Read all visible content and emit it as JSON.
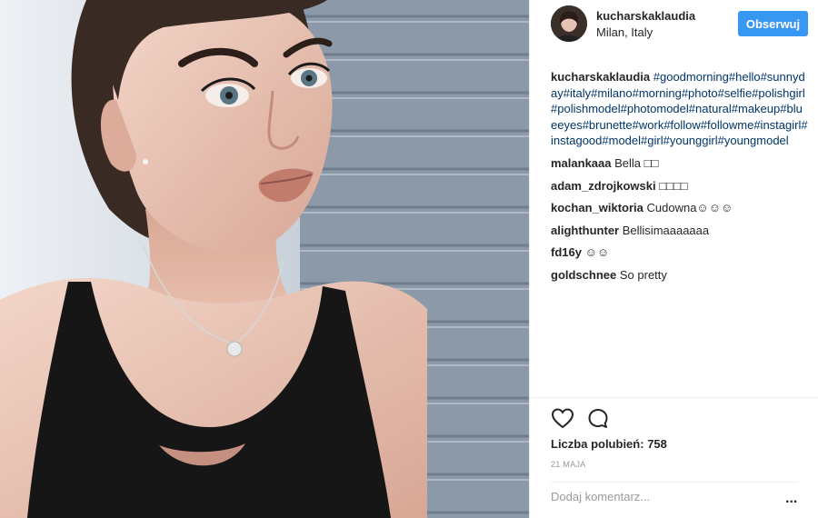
{
  "post": {
    "image_alt": "selfie photo",
    "header": {
      "username": "kucharskaklaudia",
      "location": "Milan, Italy",
      "follow_label": "Obserwuj"
    },
    "caption": {
      "username": "kucharskaklaudia",
      "hashtags": [
        "#goodmorning",
        "#hello",
        "#sunnyday",
        "#italy",
        "#milano",
        "#morning",
        "#photo",
        "#selfie",
        "#polishgirl",
        "#polishmodel",
        "#photomodel",
        "#natural",
        "#makeup",
        "#blueeyes",
        "#brunette",
        "#work",
        "#follow",
        "#followme",
        "#instagirl",
        "#instagood",
        "#model",
        "#girl",
        "#younggirl",
        "#youngmodel"
      ]
    },
    "comments": [
      {
        "user": "malankaaa",
        "text": "Bella □□"
      },
      {
        "user": "adam_zdrojkowski",
        "text": "□□□□"
      },
      {
        "user": "kochan_wiktoria",
        "text": "Cudowna☺☺☺"
      },
      {
        "user": "alighthunter",
        "text": "Bellisimaaaaaaa"
      },
      {
        "user": "fd16y",
        "text": "☺☺"
      },
      {
        "user": "goldschnee",
        "text": "So pretty"
      }
    ],
    "likes_label": "Liczba polubień:",
    "likes_count": "758",
    "date": "21 MAJA",
    "comment_placeholder": "Dodaj komentarz...",
    "more_label": "..."
  },
  "icons": {
    "like": "heart-icon",
    "comment": "speech-bubble-icon",
    "more": "ellipsis-icon"
  },
  "colors": {
    "accent": "#3897f0",
    "hashtag": "#003569",
    "muted": "#999999",
    "border": "#efefef"
  }
}
